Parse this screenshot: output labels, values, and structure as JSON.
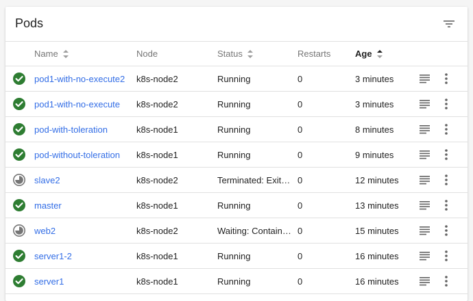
{
  "card": {
    "title": "Pods"
  },
  "columns": {
    "name": "Name",
    "node": "Node",
    "status": "Status",
    "restarts": "Restarts",
    "age": "Age"
  },
  "colors": {
    "running": "#2e7d32",
    "pending": "#757575",
    "link": "#326de6"
  },
  "rows": [
    {
      "state_icon": "check-circle-icon",
      "name": "pod1-with-no-execute2",
      "node": "k8s-node2",
      "status": "Running",
      "restarts": "0",
      "age": "3 minutes"
    },
    {
      "state_icon": "check-circle-icon",
      "name": "pod1-with-no-execute",
      "node": "k8s-node2",
      "status": "Running",
      "restarts": "0",
      "age": "3 minutes"
    },
    {
      "state_icon": "check-circle-icon",
      "name": "pod-with-toleration",
      "node": "k8s-node1",
      "status": "Running",
      "restarts": "0",
      "age": "8 minutes"
    },
    {
      "state_icon": "check-circle-icon",
      "name": "pod-without-toleration",
      "node": "k8s-node1",
      "status": "Running",
      "restarts": "0",
      "age": "9 minutes"
    },
    {
      "state_icon": "pending-circle-icon",
      "name": "slave2",
      "node": "k8s-node2",
      "status": "Terminated: Exit…",
      "restarts": "0",
      "age": "12 minutes"
    },
    {
      "state_icon": "check-circle-icon",
      "name": "master",
      "node": "k8s-node1",
      "status": "Running",
      "restarts": "0",
      "age": "13 minutes"
    },
    {
      "state_icon": "pending-circle-icon",
      "name": "web2",
      "node": "k8s-node2",
      "status": "Waiting: Contain…",
      "restarts": "0",
      "age": "15 minutes"
    },
    {
      "state_icon": "check-circle-icon",
      "name": "server1-2",
      "node": "k8s-node1",
      "status": "Running",
      "restarts": "0",
      "age": "16 minutes"
    },
    {
      "state_icon": "check-circle-icon",
      "name": "server1",
      "node": "k8s-node1",
      "status": "Running",
      "restarts": "0",
      "age": "16 minutes"
    }
  ]
}
